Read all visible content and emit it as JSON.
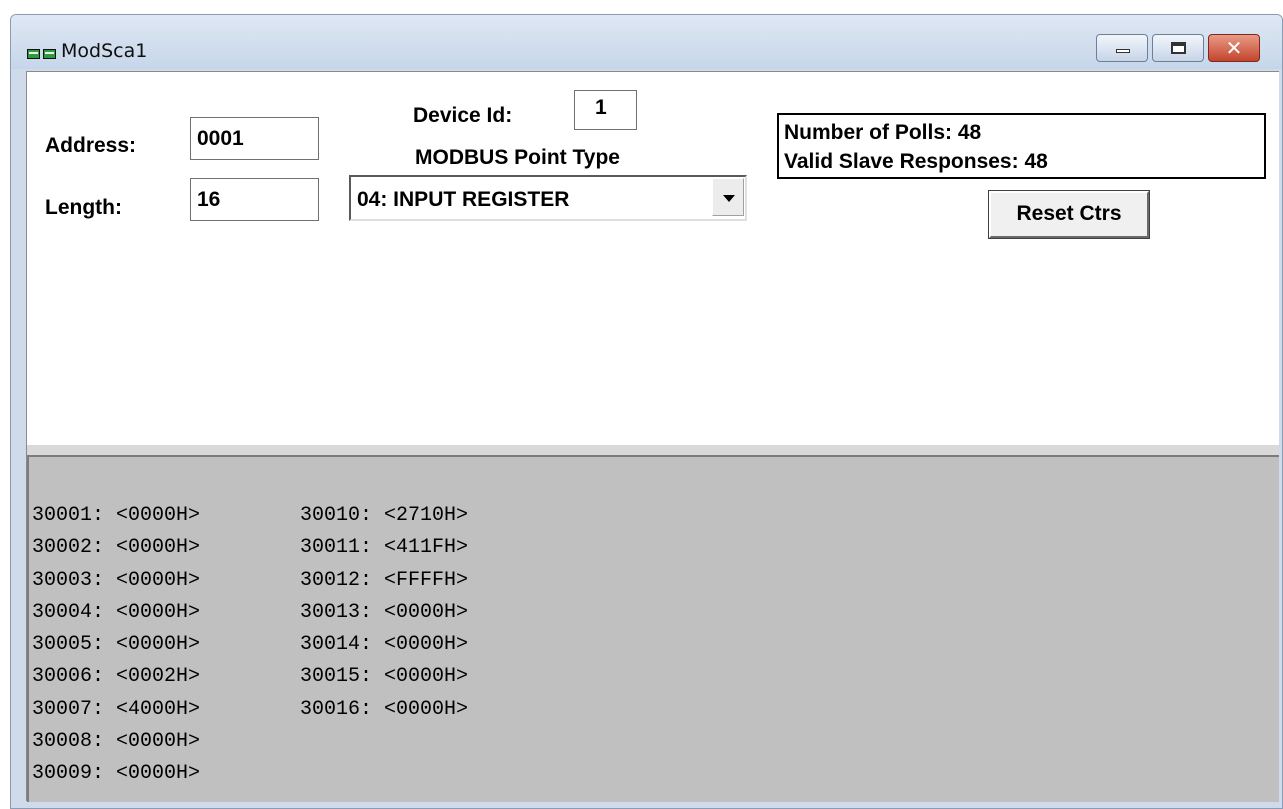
{
  "window": {
    "title": "ModSca1",
    "icon": "modscan-app-icon",
    "buttons": {
      "minimize": "minimize-icon",
      "maximize": "maximize-icon",
      "close": "✕"
    }
  },
  "form": {
    "address_label": "Address:",
    "address_value": "0001",
    "length_label": "Length:",
    "length_value": "16",
    "device_id_label": "Device Id:",
    "device_id_value": "1",
    "point_type_label": "MODBUS Point Type",
    "point_type_value": "04: INPUT REGISTER"
  },
  "counters": {
    "polls": "Number of Polls: 48",
    "valid_responses": "Valid Slave Responses: 48",
    "reset_label": "Reset Ctrs"
  },
  "registers": {
    "column_1": [
      "30001: <0000H>",
      "30002: <0000H>",
      "30003: <0000H>",
      "30004: <0000H>",
      "30005: <0000H>",
      "30006: <0002H>",
      "30007: <4000H>",
      "30008: <0000H>",
      "30009: <0000H>"
    ],
    "column_2": [
      "30010: <2710H>",
      "30011: <411FH>",
      "30012: <FFFFH>",
      "30013: <0000H>",
      "30014: <0000H>",
      "30015: <0000H>",
      "30016: <0000H>"
    ]
  },
  "colors": {
    "data_pane_bg": "#c0c0c0",
    "title_bar": "#cfdbea",
    "close_button": "#c4452d"
  }
}
